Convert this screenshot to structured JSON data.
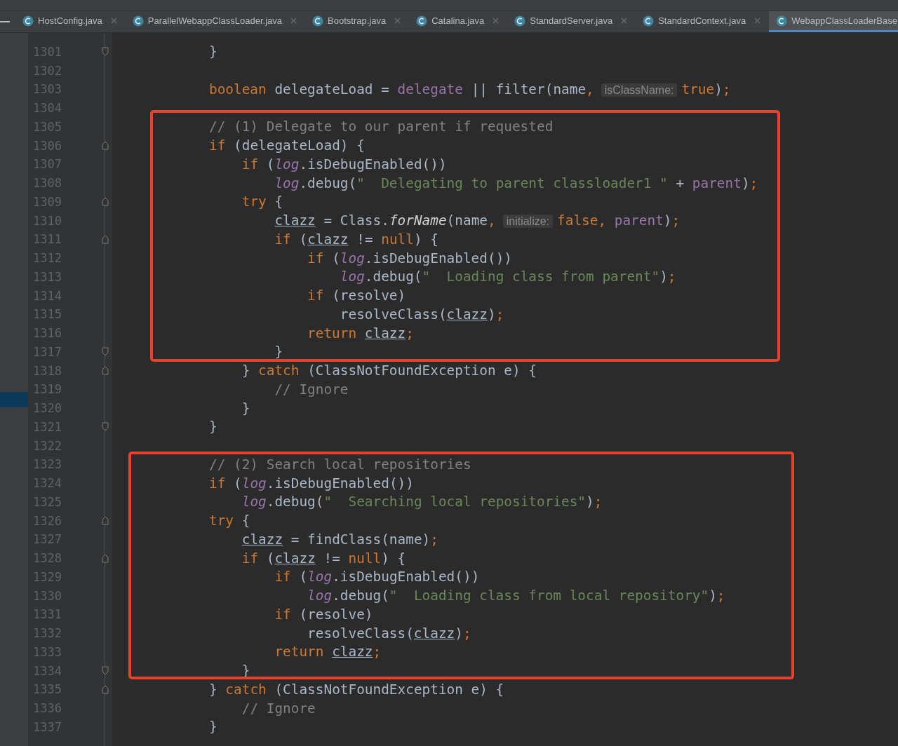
{
  "tabs": [
    {
      "label": "HostConfig.java",
      "selected": false
    },
    {
      "label": "ParallelWebappClassLoader.java",
      "selected": false
    },
    {
      "label": "Bootstrap.java",
      "selected": false
    },
    {
      "label": "Catalina.java",
      "selected": false
    },
    {
      "label": "StandardServer.java",
      "selected": false
    },
    {
      "label": "StandardContext.java",
      "selected": false
    },
    {
      "label": "WebappClassLoaderBase",
      "selected": true
    }
  ],
  "editor": {
    "lines": [
      {
        "number": "1301",
        "kind": "block-end",
        "tokens": [
          {
            "kind": "plain",
            "text": "}"
          }
        ]
      },
      {
        "number": "1302"
      },
      {
        "number": "1303",
        "tokens": [
          {
            "kind": "keyword",
            "text": "boolean"
          },
          {
            "kind": "plain",
            "text": " delegateLoad = "
          },
          {
            "kind": "field",
            "text": "delegate"
          },
          {
            "kind": "plain",
            "text": " || filter(name"
          },
          {
            "kind": "keyword",
            "text": ","
          },
          {
            "kind": "hint",
            "text": "isClassName:"
          },
          {
            "kind": "keyword",
            "text": "true"
          },
          {
            "kind": "plain",
            "text": ")"
          },
          {
            "kind": "keyword",
            "text": ";"
          }
        ]
      },
      {
        "number": "1304"
      },
      {
        "number": "1305",
        "tokens": [
          {
            "kind": "comment",
            "text": "// (1) Delegate to our parent if requested"
          }
        ]
      },
      {
        "number": "1306",
        "kind": "block-start",
        "tokens": [
          {
            "kind": "keyword",
            "text": "if"
          },
          {
            "kind": "plain",
            "text": " (delegateLoad) {"
          }
        ]
      },
      {
        "number": "1307",
        "tokens": [
          {
            "kind": "keyword",
            "text": "    if"
          },
          {
            "kind": "plain",
            "text": " ("
          },
          {
            "kind": "static",
            "text": "log"
          },
          {
            "kind": "plain",
            "text": ".isDebugEnabled())"
          }
        ]
      },
      {
        "number": "1308",
        "tokens": [
          {
            "kind": "static",
            "text": "        log"
          },
          {
            "kind": "plain",
            "text": ".debug("
          },
          {
            "kind": "string",
            "text": "\"  Delegating to parent classloader1 \""
          },
          {
            "kind": "plain",
            "text": " + "
          },
          {
            "kind": "field",
            "text": "parent"
          },
          {
            "kind": "plain",
            "text": ")"
          },
          {
            "kind": "keyword",
            "text": ";"
          }
        ]
      },
      {
        "number": "1309",
        "kind": "block-start",
        "tokens": [
          {
            "kind": "keyword",
            "text": "    try"
          },
          {
            "kind": "plain",
            "text": " {"
          }
        ]
      },
      {
        "number": "1310",
        "tokens": [
          {
            "kind": "local",
            "text": "        clazz"
          },
          {
            "kind": "plain",
            "text": " = Class."
          },
          {
            "kind": "method",
            "text": "forName"
          },
          {
            "kind": "plain",
            "text": "(name"
          },
          {
            "kind": "keyword",
            "text": ","
          },
          {
            "kind": "hint",
            "text": "initialize:"
          },
          {
            "kind": "keyword",
            "text": "false, "
          },
          {
            "kind": "field",
            "text": "parent"
          },
          {
            "kind": "plain",
            "text": ")"
          },
          {
            "kind": "keyword",
            "text": ";"
          }
        ]
      },
      {
        "number": "1311",
        "kind": "block-start",
        "tokens": [
          {
            "kind": "keyword",
            "text": "        if"
          },
          {
            "kind": "plain",
            "text": " ("
          },
          {
            "kind": "local",
            "text": "clazz"
          },
          {
            "kind": "plain",
            "text": " != "
          },
          {
            "kind": "keyword",
            "text": "null"
          },
          {
            "kind": "plain",
            "text": ") {"
          }
        ]
      },
      {
        "number": "1312",
        "tokens": [
          {
            "kind": "keyword",
            "text": "            if"
          },
          {
            "kind": "plain",
            "text": " ("
          },
          {
            "kind": "static",
            "text": "log"
          },
          {
            "kind": "plain",
            "text": ".isDebugEnabled())"
          }
        ]
      },
      {
        "number": "1313",
        "tokens": [
          {
            "kind": "static",
            "text": "                log"
          },
          {
            "kind": "plain",
            "text": ".debug("
          },
          {
            "kind": "string",
            "text": "\"  Loading class from parent\""
          },
          {
            "kind": "plain",
            "text": ")"
          },
          {
            "kind": "keyword",
            "text": ";"
          }
        ]
      },
      {
        "number": "1314",
        "tokens": [
          {
            "kind": "keyword",
            "text": "            if"
          },
          {
            "kind": "plain",
            "text": " (resolve)"
          }
        ]
      },
      {
        "number": "1315",
        "tokens": [
          {
            "kind": "plain",
            "text": "                resolveClass("
          },
          {
            "kind": "local",
            "text": "clazz"
          },
          {
            "kind": "plain",
            "text": ")"
          },
          {
            "kind": "keyword",
            "text": ";"
          }
        ]
      },
      {
        "number": "1316",
        "tokens": [
          {
            "kind": "keyword",
            "text": "            return "
          },
          {
            "kind": "local",
            "text": "clazz"
          },
          {
            "kind": "keyword",
            "text": ";"
          }
        ]
      },
      {
        "number": "1317",
        "kind": "block-end",
        "tokens": [
          {
            "kind": "plain",
            "text": "        }"
          }
        ]
      },
      {
        "number": "1318",
        "kind": "block-start",
        "tokens": [
          {
            "kind": "plain",
            "text": "    } "
          },
          {
            "kind": "keyword",
            "text": "catch"
          },
          {
            "kind": "plain",
            "text": " (ClassNotFoundException e) {"
          }
        ]
      },
      {
        "number": "1319",
        "tokens": [
          {
            "kind": "comment",
            "text": "        // Ignore"
          }
        ]
      },
      {
        "number": "1320",
        "tokens": [
          {
            "kind": "plain",
            "text": "    }"
          }
        ]
      },
      {
        "number": "1321",
        "kind": "block-end",
        "tokens": [
          {
            "kind": "plain",
            "text": "}"
          }
        ]
      },
      {
        "number": "1322"
      },
      {
        "number": "1323",
        "tokens": [
          {
            "kind": "comment",
            "text": "// (2) Search local repositories"
          }
        ]
      },
      {
        "number": "1324",
        "tokens": [
          {
            "kind": "keyword",
            "text": "if"
          },
          {
            "kind": "plain",
            "text": " ("
          },
          {
            "kind": "static",
            "text": "log"
          },
          {
            "kind": "plain",
            "text": ".isDebugEnabled())"
          }
        ]
      },
      {
        "number": "1325",
        "tokens": [
          {
            "kind": "static",
            "text": "    log"
          },
          {
            "kind": "plain",
            "text": ".debug("
          },
          {
            "kind": "string",
            "text": "\"  Searching local repositories\""
          },
          {
            "kind": "plain",
            "text": ")"
          },
          {
            "kind": "keyword",
            "text": ";"
          }
        ]
      },
      {
        "number": "1326",
        "kind": "block-start",
        "tokens": [
          {
            "kind": "keyword",
            "text": "try"
          },
          {
            "kind": "plain",
            "text": " {"
          }
        ]
      },
      {
        "number": "1327",
        "tokens": [
          {
            "kind": "local",
            "text": "    clazz"
          },
          {
            "kind": "plain",
            "text": " = findClass(name)"
          },
          {
            "kind": "keyword",
            "text": ";"
          }
        ]
      },
      {
        "number": "1328",
        "kind": "block-start",
        "tokens": [
          {
            "kind": "keyword",
            "text": "    if"
          },
          {
            "kind": "plain",
            "text": " ("
          },
          {
            "kind": "local",
            "text": "clazz"
          },
          {
            "kind": "plain",
            "text": " != "
          },
          {
            "kind": "keyword",
            "text": "null"
          },
          {
            "kind": "plain",
            "text": ") {"
          }
        ]
      },
      {
        "number": "1329",
        "tokens": [
          {
            "kind": "keyword",
            "text": "        if"
          },
          {
            "kind": "plain",
            "text": " ("
          },
          {
            "kind": "static",
            "text": "log"
          },
          {
            "kind": "plain",
            "text": ".isDebugEnabled())"
          }
        ]
      },
      {
        "number": "1330",
        "tokens": [
          {
            "kind": "static",
            "text": "            log"
          },
          {
            "kind": "plain",
            "text": ".debug("
          },
          {
            "kind": "string",
            "text": "\"  Loading class from local repository\""
          },
          {
            "kind": "plain",
            "text": ")"
          },
          {
            "kind": "keyword",
            "text": ";"
          }
        ]
      },
      {
        "number": "1331",
        "tokens": [
          {
            "kind": "keyword",
            "text": "        if"
          },
          {
            "kind": "plain",
            "text": " (resolve)"
          }
        ]
      },
      {
        "number": "1332",
        "tokens": [
          {
            "kind": "plain",
            "text": "            resolveClass("
          },
          {
            "kind": "local",
            "text": "clazz"
          },
          {
            "kind": "plain",
            "text": ")"
          },
          {
            "kind": "keyword",
            "text": ";"
          }
        ]
      },
      {
        "number": "1333",
        "tokens": [
          {
            "kind": "keyword",
            "text": "        return "
          },
          {
            "kind": "local",
            "text": "clazz"
          },
          {
            "kind": "keyword",
            "text": ";"
          }
        ]
      },
      {
        "number": "1334",
        "kind": "block-end",
        "tokens": [
          {
            "kind": "plain",
            "text": "    }"
          }
        ]
      },
      {
        "number": "1335",
        "kind": "block-start",
        "tokens": [
          {
            "kind": "plain",
            "text": "} "
          },
          {
            "kind": "keyword",
            "text": "catch"
          },
          {
            "kind": "plain",
            "text": " (ClassNotFoundException e) {"
          }
        ]
      },
      {
        "number": "1336",
        "tokens": [
          {
            "kind": "comment",
            "text": "    // Ignore"
          }
        ]
      },
      {
        "number": "1337",
        "tokens": [
          {
            "kind": "plain",
            "text": "}"
          }
        ]
      }
    ]
  }
}
